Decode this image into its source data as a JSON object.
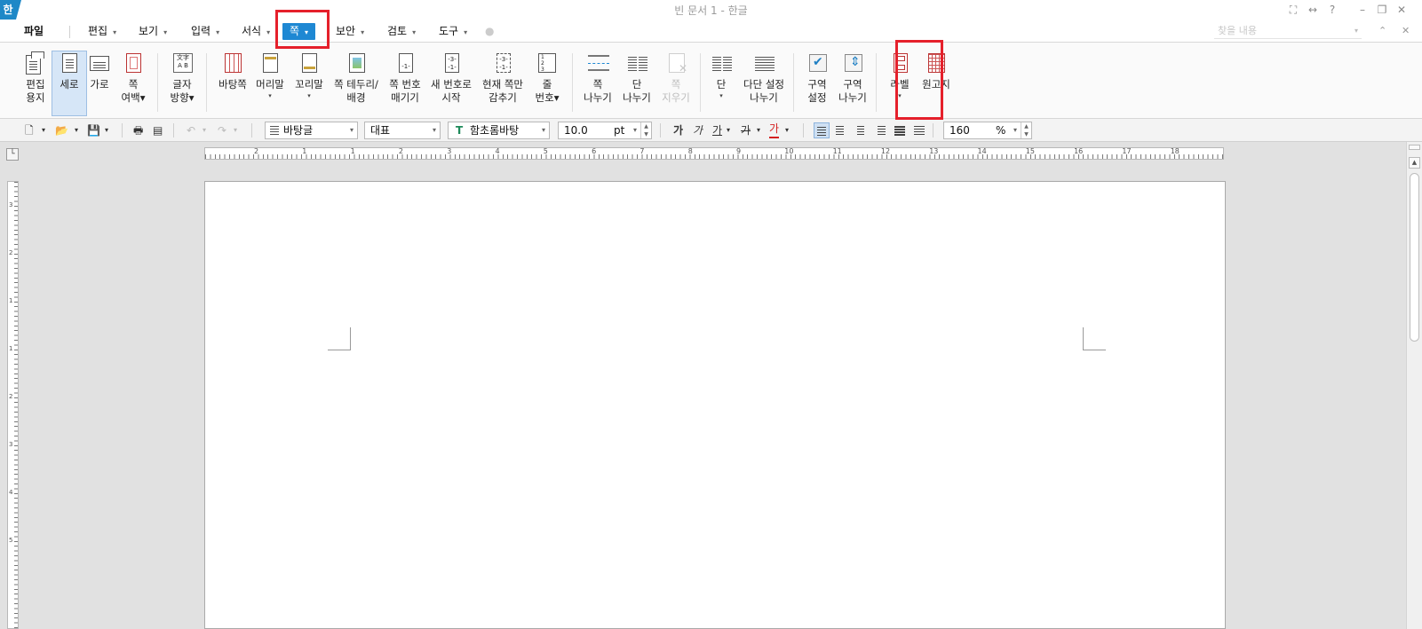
{
  "titlebar": {
    "logo": "한",
    "title": "빈 문서 1 - 한글",
    "icons": [
      "fullscreen-icon",
      "resize-icon",
      "help-icon",
      "minimize-icon",
      "restore-icon",
      "close-icon"
    ],
    "icon_glyphs": [
      "⛶",
      "↔",
      "?",
      "–",
      "❐",
      "✕"
    ]
  },
  "menubar": {
    "items": [
      {
        "label": "파일",
        "has_arrow": false
      },
      {
        "label": "편집",
        "has_arrow": true
      },
      {
        "label": "보기",
        "has_arrow": true
      },
      {
        "label": "입력",
        "has_arrow": true
      },
      {
        "label": "서식",
        "has_arrow": true
      },
      {
        "label": "쪽",
        "has_arrow": true,
        "active": true
      },
      {
        "label": "보안",
        "has_arrow": true
      },
      {
        "label": "검토",
        "has_arrow": true
      },
      {
        "label": "도구",
        "has_arrow": true
      }
    ],
    "arrow_glyph": "▾",
    "find_placeholder": "찾을 내용",
    "right_glyphs": [
      "⌃",
      "✕"
    ]
  },
  "ribbon": {
    "buttons": [
      {
        "id": "edit-paper",
        "label": "편집\n용지",
        "dropdown": false
      },
      {
        "id": "portrait",
        "label": "세로",
        "dropdown": false,
        "selected": true
      },
      {
        "id": "landscape",
        "label": "가로",
        "dropdown": false
      },
      {
        "id": "page-margin",
        "label": "쪽\n여백▾",
        "dropdown": false
      },
      {
        "id": "text-direction",
        "label": "글자\n방향▾",
        "dropdown": false,
        "icon_text": "文字\nA B"
      },
      {
        "id": "master-page",
        "label": "바탕쪽",
        "dropdown": false
      },
      {
        "id": "header",
        "label": "머리말",
        "dropdown": true
      },
      {
        "id": "footer",
        "label": "꼬리말",
        "dropdown": true
      },
      {
        "id": "page-border",
        "label": "쪽 테두리/\n배경",
        "dropdown": false
      },
      {
        "id": "page-number",
        "label": "쪽 번호\n매기기",
        "dropdown": false,
        "icon_text": "-1-"
      },
      {
        "id": "new-number",
        "label": "새 번호로\n시작",
        "dropdown": false,
        "icon_text": "-3-\n-1-"
      },
      {
        "id": "hide-current",
        "label": "현재 쪽만\n감추기",
        "dropdown": false,
        "icon_text": "-3-\n-1-"
      },
      {
        "id": "line-number",
        "label": "줄\n번호▾",
        "dropdown": false,
        "icon_text": "1\n2\n3"
      },
      {
        "id": "page-break",
        "label": "쪽\n나누기",
        "dropdown": false
      },
      {
        "id": "column-break",
        "label": "단\n나누기",
        "dropdown": false
      },
      {
        "id": "delete-page",
        "label": "쪽\n지우기",
        "dropdown": false,
        "disabled": true
      },
      {
        "id": "columns",
        "label": "단",
        "dropdown": true
      },
      {
        "id": "multi-column",
        "label": "다단 설정\n나누기",
        "dropdown": false
      },
      {
        "id": "section-setup",
        "label": "구역\n설정",
        "dropdown": false
      },
      {
        "id": "section-break",
        "label": "구역\n나누기",
        "dropdown": false
      },
      {
        "id": "label",
        "label": "라벨",
        "dropdown": true
      },
      {
        "id": "manuscript",
        "label": "원고지",
        "dropdown": false
      }
    ],
    "dropdown_glyph": "▾"
  },
  "format": {
    "icons": {
      "new": "🗋",
      "open": "📂",
      "save": "💾",
      "print": "🖶",
      "preview": "▤",
      "undo": "↶",
      "redo": "↷",
      "arrow": "▾"
    },
    "style": "바탕글",
    "lang": "대표",
    "font_icon": "T",
    "font": "함초롬바탕",
    "size": "10.0",
    "unit": "pt",
    "spin_glyphs": [
      "▲",
      "▼"
    ],
    "bold": "가",
    "italic": "가",
    "underline": "가",
    "strike": "가",
    "color": "가",
    "zoom": "160",
    "zoom_unit": "%"
  },
  "ruler": {
    "corner": "└",
    "h_numbers": [
      "2",
      "1",
      "1",
      "2",
      "3",
      "4",
      "5",
      "6",
      "7",
      "8",
      "9",
      "10",
      "11",
      "12",
      "13",
      "14",
      "15",
      "16",
      "17",
      "18"
    ],
    "v_numbers": [
      "3",
      "2",
      "1",
      "1",
      "2",
      "3",
      "4",
      "5"
    ]
  },
  "scrollbar": {
    "up": "▲"
  }
}
